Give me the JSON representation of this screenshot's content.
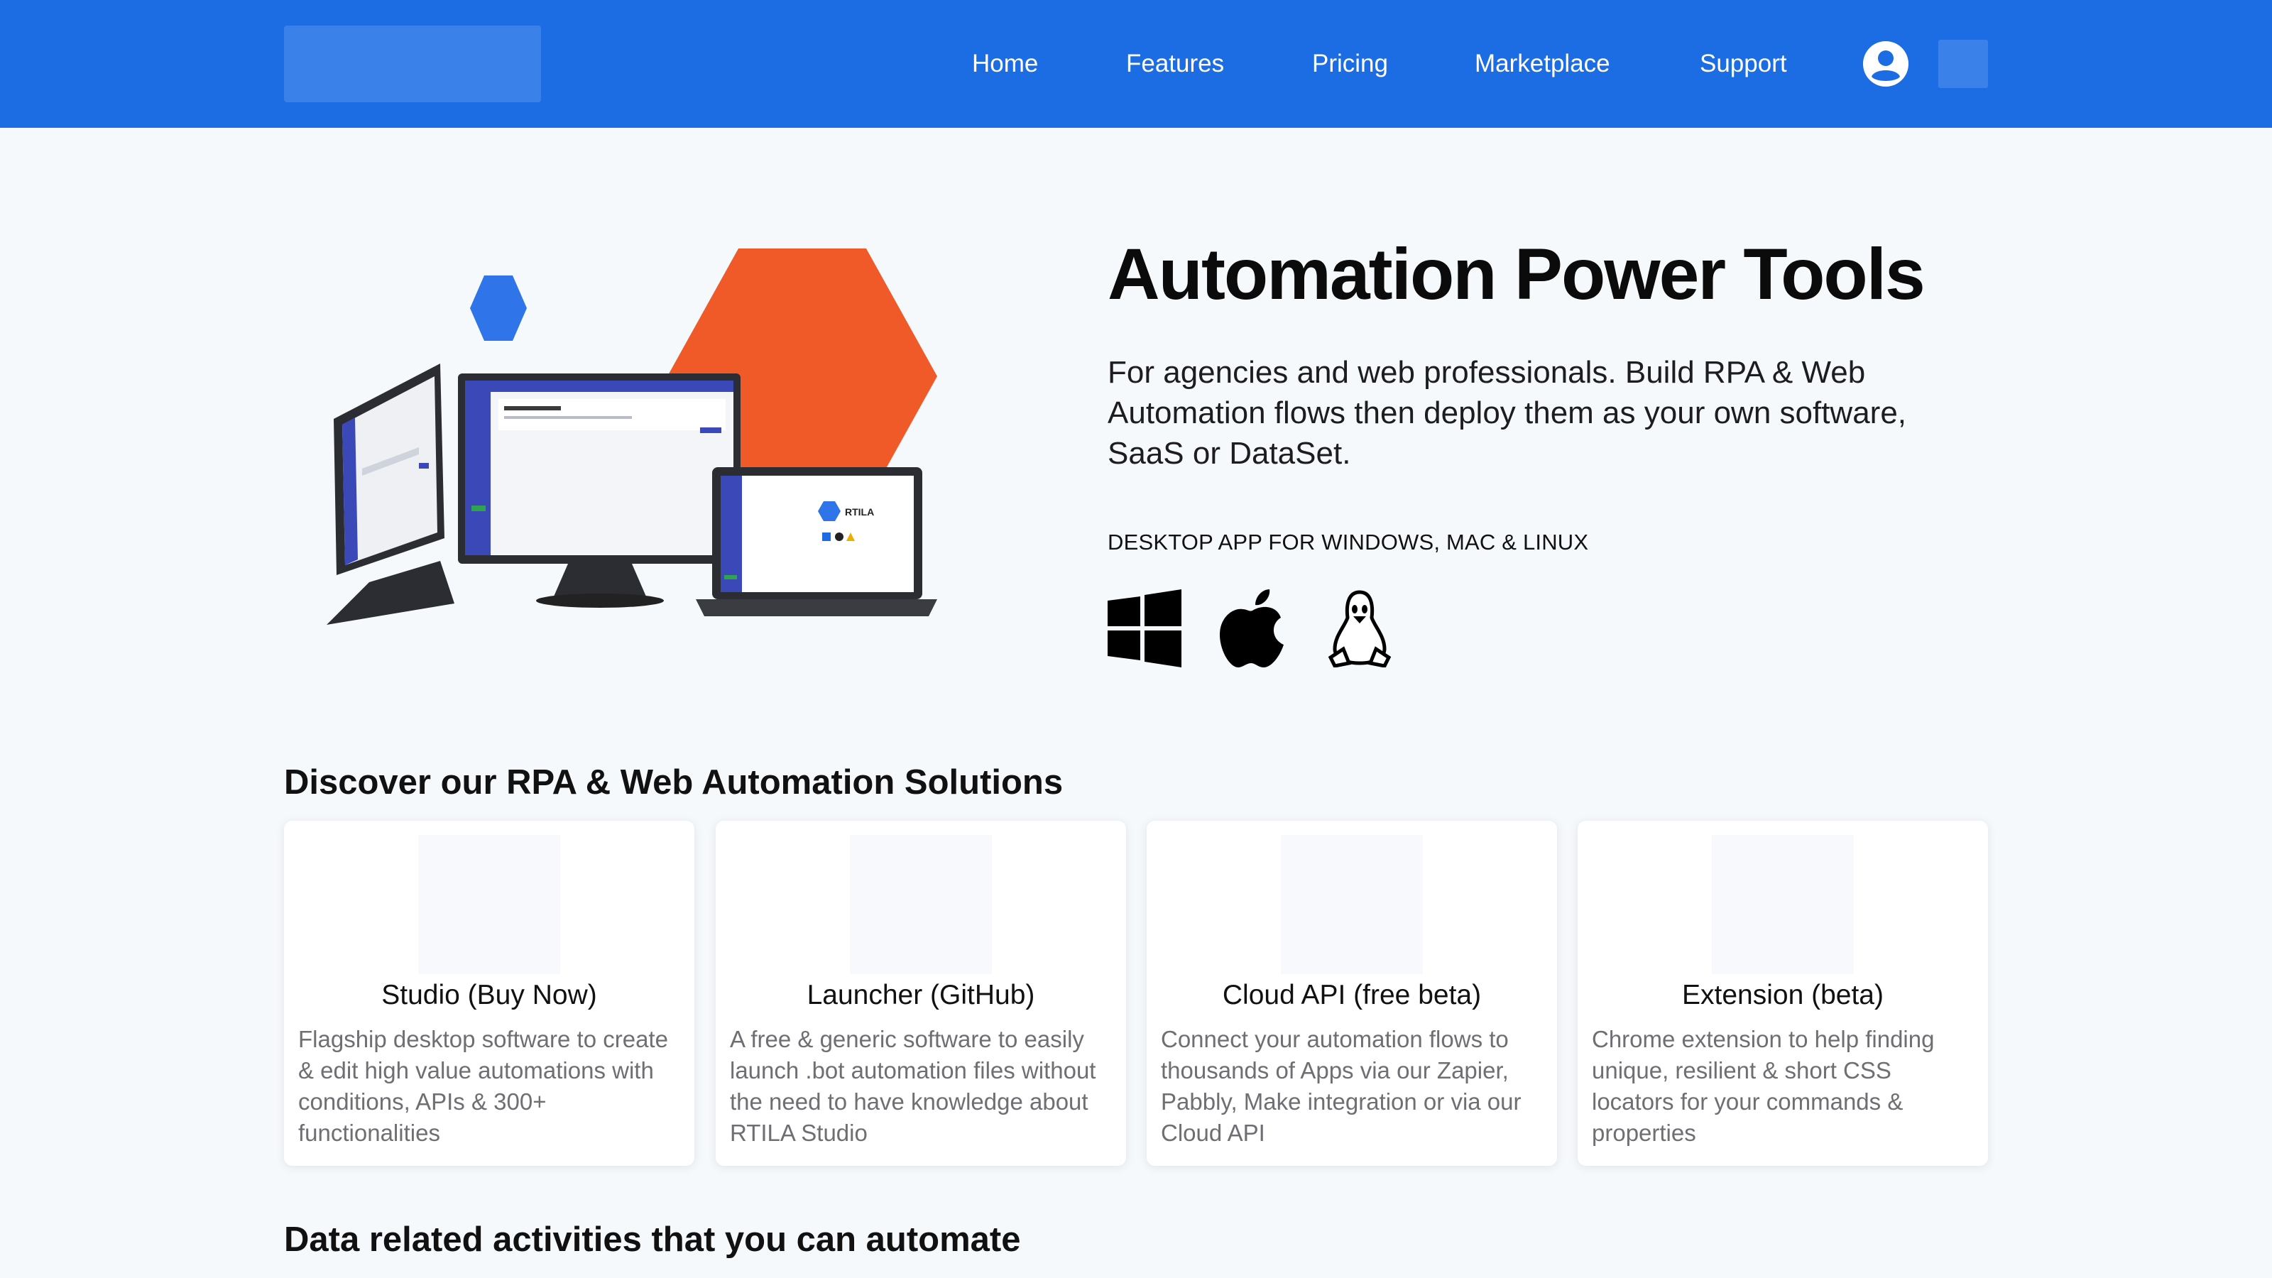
{
  "nav": {
    "links": [
      {
        "label": "Home"
      },
      {
        "label": "Features"
      },
      {
        "label": "Pricing"
      },
      {
        "label": "Marketplace"
      },
      {
        "label": "Support"
      }
    ],
    "user_icon": "user-circle-icon",
    "colors": {
      "bar": "#1c6de3",
      "placeholder": "#3a82ea"
    }
  },
  "hero": {
    "title": "Automation Power Tools",
    "subtitle": "For agencies and web professionals. Build RPA & Web Automation flows then deploy them as your own software, SaaS or DataSet.",
    "platform_label": "DESKTOP APP FOR WINDOWS, MAC & LINUX",
    "os_icons": [
      "windows-icon",
      "apple-icon",
      "linux-icon"
    ],
    "illustration_brand": "RTILA",
    "colors": {
      "hex_blue": "#2f74e8",
      "hex_orange": "#f05a28"
    }
  },
  "solutions": {
    "heading": "Discover our RPA & Web Automation Solutions",
    "cards": [
      {
        "title": "Studio (Buy Now)",
        "description": "Flagship desktop software to create & edit high value automations with conditions, APIs & 300+ functionalities"
      },
      {
        "title": "Launcher (GitHub)",
        "description": "A free & generic software to easily launch .bot automation files without the need to have knowledge about RTILA Studio"
      },
      {
        "title": "Cloud API (free beta)",
        "description": "Connect your automation flows to thousands of Apps via our Zapier, Pabbly, Make integration or via our Cloud API"
      },
      {
        "title": "Extension (beta)",
        "description": "Chrome extension to help finding unique, resilient & short CSS locators for your commands & properties"
      }
    ]
  },
  "activities": {
    "heading": "Data related activities that you can automate"
  }
}
